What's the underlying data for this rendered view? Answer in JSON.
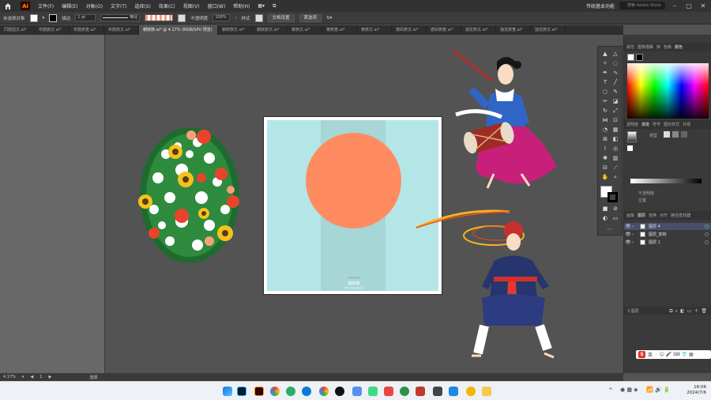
{
  "app": {
    "logo_text": "Ai",
    "menu": [
      "文件(F)",
      "编辑(E)",
      "对象(O)",
      "文字(T)",
      "选择(S)",
      "效果(C)",
      "视图(V)",
      "窗口(W)",
      "帮助(H)"
    ],
    "workspace": "传统基本功能",
    "search_placeholder": "搜索 Adobe Stock"
  },
  "control_bar": {
    "selection": "未选择对象",
    "stroke_label": "描边",
    "stroke_width": "1 pt",
    "stroke_style": "等比",
    "opacity_label": "不透明度",
    "opacity_value": "100%",
    "style_label": "样式",
    "doc_setup_button": "文档设置",
    "prefs_button": "首选项"
  },
  "tabs": [
    {
      "label": "同题团文.ai*",
      "active": false
    },
    {
      "label": "布鼓旅文.ai*",
      "active": false
    },
    {
      "label": "布鼓旅宽.ai*",
      "active": false
    },
    {
      "label": "布鼓旅文.ai*",
      "active": false
    },
    {
      "label": "朝鲜族.ai* @ 4.17% (RGB/GPU 预览)",
      "active": true
    },
    {
      "label": "朝鲜族文.ai*",
      "active": false
    },
    {
      "label": "朝鲜旅文.ai*",
      "active": false
    },
    {
      "label": "傣族文.ai*",
      "active": false
    },
    {
      "label": "傣族宽.ai*",
      "active": false
    },
    {
      "label": "傣族文.ai*",
      "active": false
    },
    {
      "label": "德昂族文.ai*",
      "active": false
    },
    {
      "label": "德昂族宽.ai*",
      "active": false
    },
    {
      "label": "独龙族文.ai*",
      "active": false
    },
    {
      "label": "独龙族宽.ai*",
      "active": false
    },
    {
      "label": "独龙族文.ai*",
      "active": false
    }
  ],
  "artboard": {
    "subtitle": "Joseonjok",
    "title": "朝鲜族",
    "caption": "中华民族大家庭成员之一",
    "colors": {
      "background": "#b4e6e7",
      "strip": "#a6d6d6",
      "circle": "#ff8c60"
    }
  },
  "right_panel": {
    "top_tabs": [
      "属性",
      "图像描摹",
      "库",
      "色板",
      "颜色"
    ],
    "mid_tabs": [
      "透明度",
      "渐变",
      "符号",
      "图形样式",
      "外观"
    ],
    "gradient_type_label": "类型",
    "opacity_label": "不透明度",
    "location_label": "位置",
    "layer_tabs": [
      "画板",
      "图层",
      "变换",
      "对齐",
      "路径查找器"
    ],
    "layers": [
      {
        "name": "图层 4",
        "selected": true
      },
      {
        "name": "图层_复制",
        "selected": false
      },
      {
        "name": "图层 1",
        "selected": false
      }
    ],
    "layer_count": "3 图层"
  },
  "status": {
    "zoom": "4.17%",
    "page": "1",
    "mode": "选择"
  },
  "taskbar": {
    "time": "18:06",
    "date": "2024/7/6",
    "ime_label": "英"
  }
}
